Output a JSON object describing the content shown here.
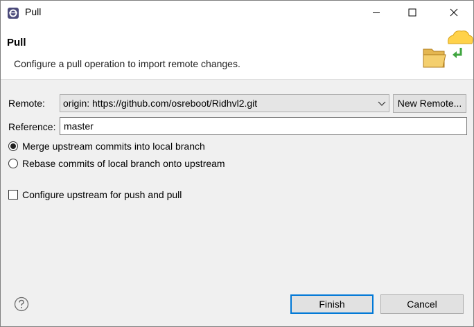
{
  "window": {
    "title": "Pull",
    "app_icon": "eclipse-icon",
    "controls": [
      "minimize-icon",
      "maximize-icon",
      "close-icon"
    ]
  },
  "banner": {
    "title": "Pull",
    "description": "Configure a pull operation to import remote changes.",
    "graphic": "folder-cloud-pull-icon"
  },
  "form": {
    "remote_label": "Remote:",
    "remote_value": "origin: https://github.com/osreboot/Ridhvl2.git",
    "new_remote_label": "New Remote...",
    "reference_label": "Reference:",
    "reference_value": "master",
    "merge_option": "Merge upstream commits into local branch",
    "rebase_option": "Rebase commits of local branch onto upstream",
    "selected_option": "merge",
    "configure_upstream_label": "Configure upstream for push and pull",
    "configure_upstream_checked": false
  },
  "footer": {
    "help_icon": "help-icon",
    "finish_label": "Finish",
    "cancel_label": "Cancel"
  },
  "colors": {
    "accent": "#0078d7",
    "background": "#f0f0f0"
  }
}
